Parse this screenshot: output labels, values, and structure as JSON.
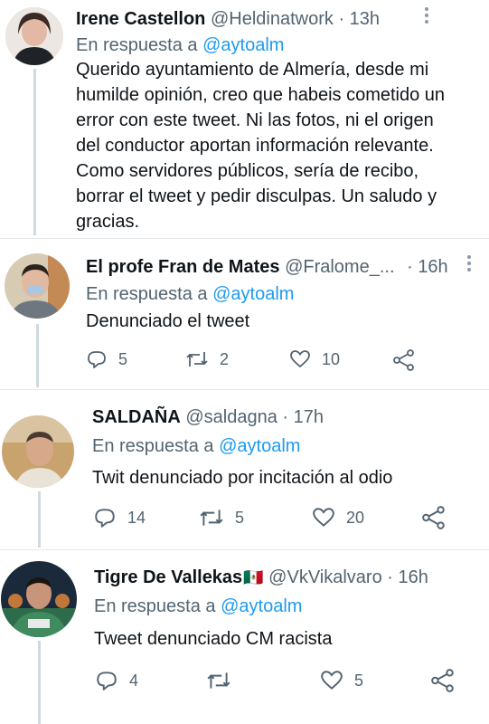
{
  "tweets": [
    {
      "name": "Irene Castellon",
      "handle": "@Heldinatwork",
      "sep": "·",
      "time": "13h",
      "reply_prefix": "En respuesta a",
      "reply_to": "@aytoalm",
      "text": "Querido ayuntamiento de Almería, desde mi humilde opinión, creo que habeis cometido un error con este tweet. Ni las fotos, ni el origen del conductor aportan información relevante. Como servidores públicos, sería de recibo, borrar el tweet y pedir disculpas. Un saludo y gracias."
    },
    {
      "name": "El profe Fran de Mates",
      "handle": "@Fralome_...",
      "sep": "·",
      "time": "16h",
      "reply_prefix": "En respuesta a",
      "reply_to": "@aytoalm",
      "text": "Denunciado el tweet",
      "replies": "5",
      "retweets": "2",
      "likes": "10"
    },
    {
      "name": "SALDAÑA",
      "handle": "@saldagna",
      "sep": "·",
      "time": "17h",
      "reply_prefix": "En respuesta a",
      "reply_to": "@aytoalm",
      "text": "Twit denunciado por incitación al odio",
      "replies": "14",
      "retweets": "5",
      "likes": "20"
    },
    {
      "name": "Tigre De Vallekas",
      "name_flag": "🇲🇽",
      "handle": "@VkVikalvaro",
      "sep": "·",
      "time": "16h",
      "reply_prefix": "En respuesta a",
      "reply_to": "@aytoalm",
      "text": "Tweet denunciado CM racista",
      "replies": "4",
      "retweets": "",
      "likes": "5"
    }
  ],
  "colors": {
    "link": "#1d9bf0",
    "secondary": "#536471",
    "thread": "#cfd9de",
    "divider": "#e6e9ec"
  }
}
